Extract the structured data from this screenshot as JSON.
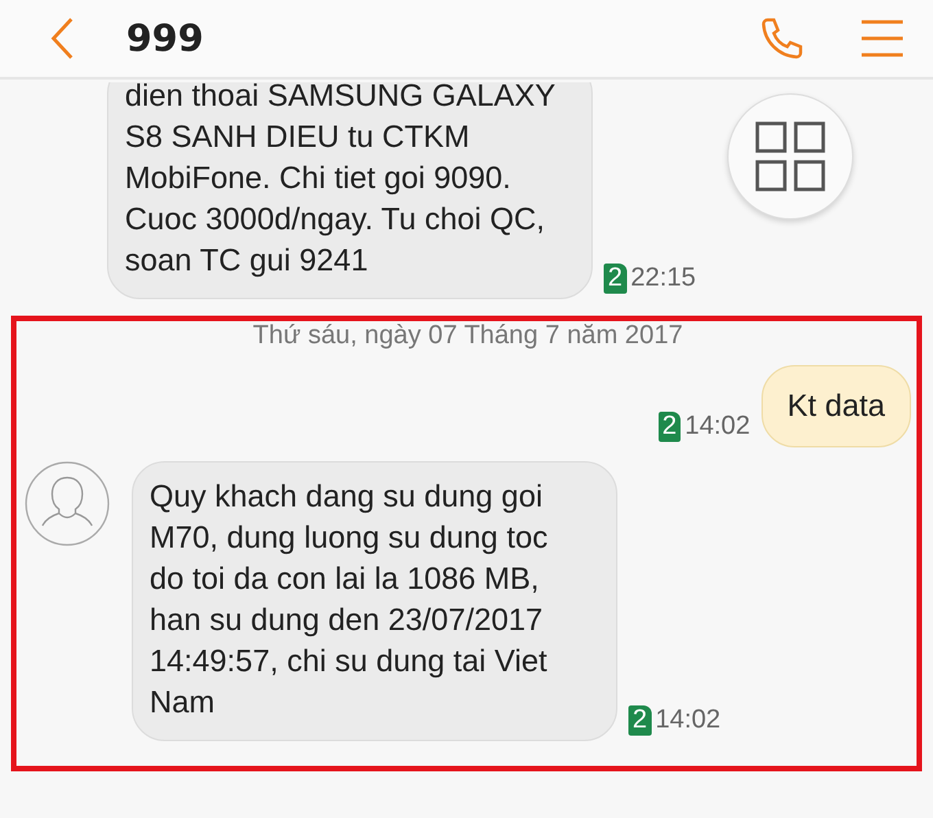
{
  "header": {
    "title": "999"
  },
  "sections": [
    {
      "highlighted": false,
      "items": [
        {
          "kind": "incoming",
          "avatar": false,
          "text": "dien thoai SAMSUNG GALAXY S8 SANH DIEU tu CTKM MobiFone. Chi tiet goi 9090. Cuoc 3000d/ngay. Tu choi QC, soan TC gui 9241",
          "sim": "2",
          "time": "22:15"
        }
      ]
    },
    {
      "highlighted": true,
      "items": [
        {
          "kind": "date",
          "text": "Thứ sáu, ngày 07 Tháng 7 năm 2017"
        },
        {
          "kind": "outgoing",
          "text": "Kt data",
          "sim": "2",
          "time": "14:02"
        },
        {
          "kind": "incoming",
          "avatar": true,
          "text": "Quy khach dang su dung goi M70, dung luong su dung toc do toi da con lai la 1086 MB, han su dung den 23/07/2017 14:49:57, chi su dung tai Viet Nam",
          "sim": "2",
          "time": "14:02"
        }
      ]
    }
  ]
}
